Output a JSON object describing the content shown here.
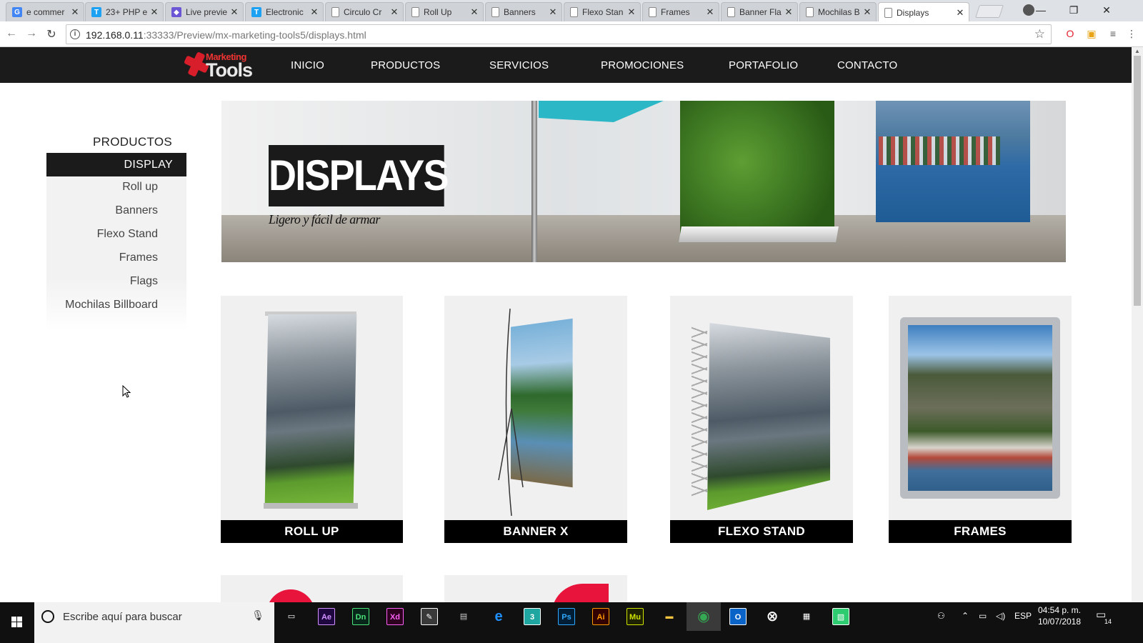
{
  "browser": {
    "tabs": [
      {
        "label": "e commer",
        "icon": "google-icon",
        "icon_color": "#4285f4"
      },
      {
        "label": "23+ PHP e",
        "icon": "t-icon",
        "icon_color": "#1da1f2"
      },
      {
        "label": "Live previe",
        "icon": "themeforest-icon",
        "icon_color": "#6b57d6"
      },
      {
        "label": "Electronic",
        "icon": "t-icon",
        "icon_color": "#1da1f2"
      },
      {
        "label": "Circulo Cr",
        "icon": "page-icon",
        "icon_color": "#888888"
      },
      {
        "label": "Roll Up",
        "icon": "page-icon",
        "icon_color": "#888888"
      },
      {
        "label": "Banners",
        "icon": "page-icon",
        "icon_color": "#888888"
      },
      {
        "label": "Flexo Stan",
        "icon": "page-icon",
        "icon_color": "#888888"
      },
      {
        "label": "Frames",
        "icon": "page-icon",
        "icon_color": "#888888"
      },
      {
        "label": "Banner Fla",
        "icon": "page-icon",
        "icon_color": "#888888"
      },
      {
        "label": "Mochilas B",
        "icon": "page-icon",
        "icon_color": "#888888"
      },
      {
        "label": "Displays",
        "icon": "page-icon",
        "icon_color": "#888888",
        "active": true
      }
    ],
    "url_host": "192.168.0.11",
    "url_rest": ":33333/Preview/mx-marketing-tools5/displays.html"
  },
  "site": {
    "logo_top": "Marketing",
    "logo_bottom": "Tools",
    "nav": [
      "INICIO",
      "PRODUCTOS",
      "SERVICIOS",
      "PROMOCIONES",
      "PORTAFOLIO",
      "CONTACTO"
    ],
    "sidebar": {
      "heading": "PRODUCTOS",
      "active": "DISPLAY",
      "items": [
        "Roll up",
        "Banners",
        "Flexo Stand",
        "Frames",
        "Flags",
        "Mochilas Billboard"
      ]
    },
    "banner": {
      "title": "DISPLAYS",
      "subtitle": "Ligero y fácil de armar"
    },
    "products": [
      "ROLL UP",
      "BANNER X",
      "FLEXO STAND",
      "FRAMES"
    ]
  },
  "taskbar": {
    "search_placeholder": "Escribe aquí para buscar",
    "apps": [
      {
        "name": "task-view-icon",
        "glyph": "▭",
        "color": "#ffffff",
        "bg": "transparent"
      },
      {
        "name": "after-effects-icon",
        "glyph": "Ae",
        "color": "#d291ff",
        "bg": "#1f0740"
      },
      {
        "name": "dimension-icon",
        "glyph": "Dn",
        "color": "#4be37a",
        "bg": "#08261a"
      },
      {
        "name": "xd-icon",
        "glyph": "Xd",
        "color": "#ff61f6",
        "bg": "#2e001f"
      },
      {
        "name": "inkscape-icon",
        "glyph": "✎",
        "color": "#ffffff",
        "bg": "#3a3a3a"
      },
      {
        "name": "scanner-icon",
        "glyph": "▤",
        "color": "#cccccc",
        "bg": "transparent"
      },
      {
        "name": "edge-icon",
        "glyph": "e",
        "color": "#1e90ff",
        "bg": "transparent"
      },
      {
        "name": "3d-builder-icon",
        "glyph": "3",
        "color": "#ffffff",
        "bg": "#1fa6a0"
      },
      {
        "name": "photoshop-icon",
        "glyph": "Ps",
        "color": "#31a8ff",
        "bg": "#001e36"
      },
      {
        "name": "illustrator-icon",
        "glyph": "Ai",
        "color": "#ff9a00",
        "bg": "#330000"
      },
      {
        "name": "muse-icon",
        "glyph": "Mu",
        "color": "#d0e500",
        "bg": "#1e2200"
      },
      {
        "name": "file-explorer-icon",
        "glyph": "▬",
        "color": "#f5c542",
        "bg": "transparent"
      },
      {
        "name": "chrome-icon",
        "glyph": "◉",
        "color": "#34a853",
        "bg": "transparent"
      },
      {
        "name": "outlook-icon",
        "glyph": "O",
        "color": "#ffffff",
        "bg": "#0a64c8"
      },
      {
        "name": "xbox-icon",
        "glyph": "⊗",
        "color": "#ffffff",
        "bg": "transparent"
      },
      {
        "name": "store-icon",
        "glyph": "▦",
        "color": "#ffffff",
        "bg": "transparent"
      },
      {
        "name": "sheets-app-icon",
        "glyph": "▧",
        "color": "#ffffff",
        "bg": "#2ecc71"
      }
    ],
    "lang": "ESP",
    "time": "04:54 p. m.",
    "date": "10/07/2018",
    "notifications": "14"
  }
}
